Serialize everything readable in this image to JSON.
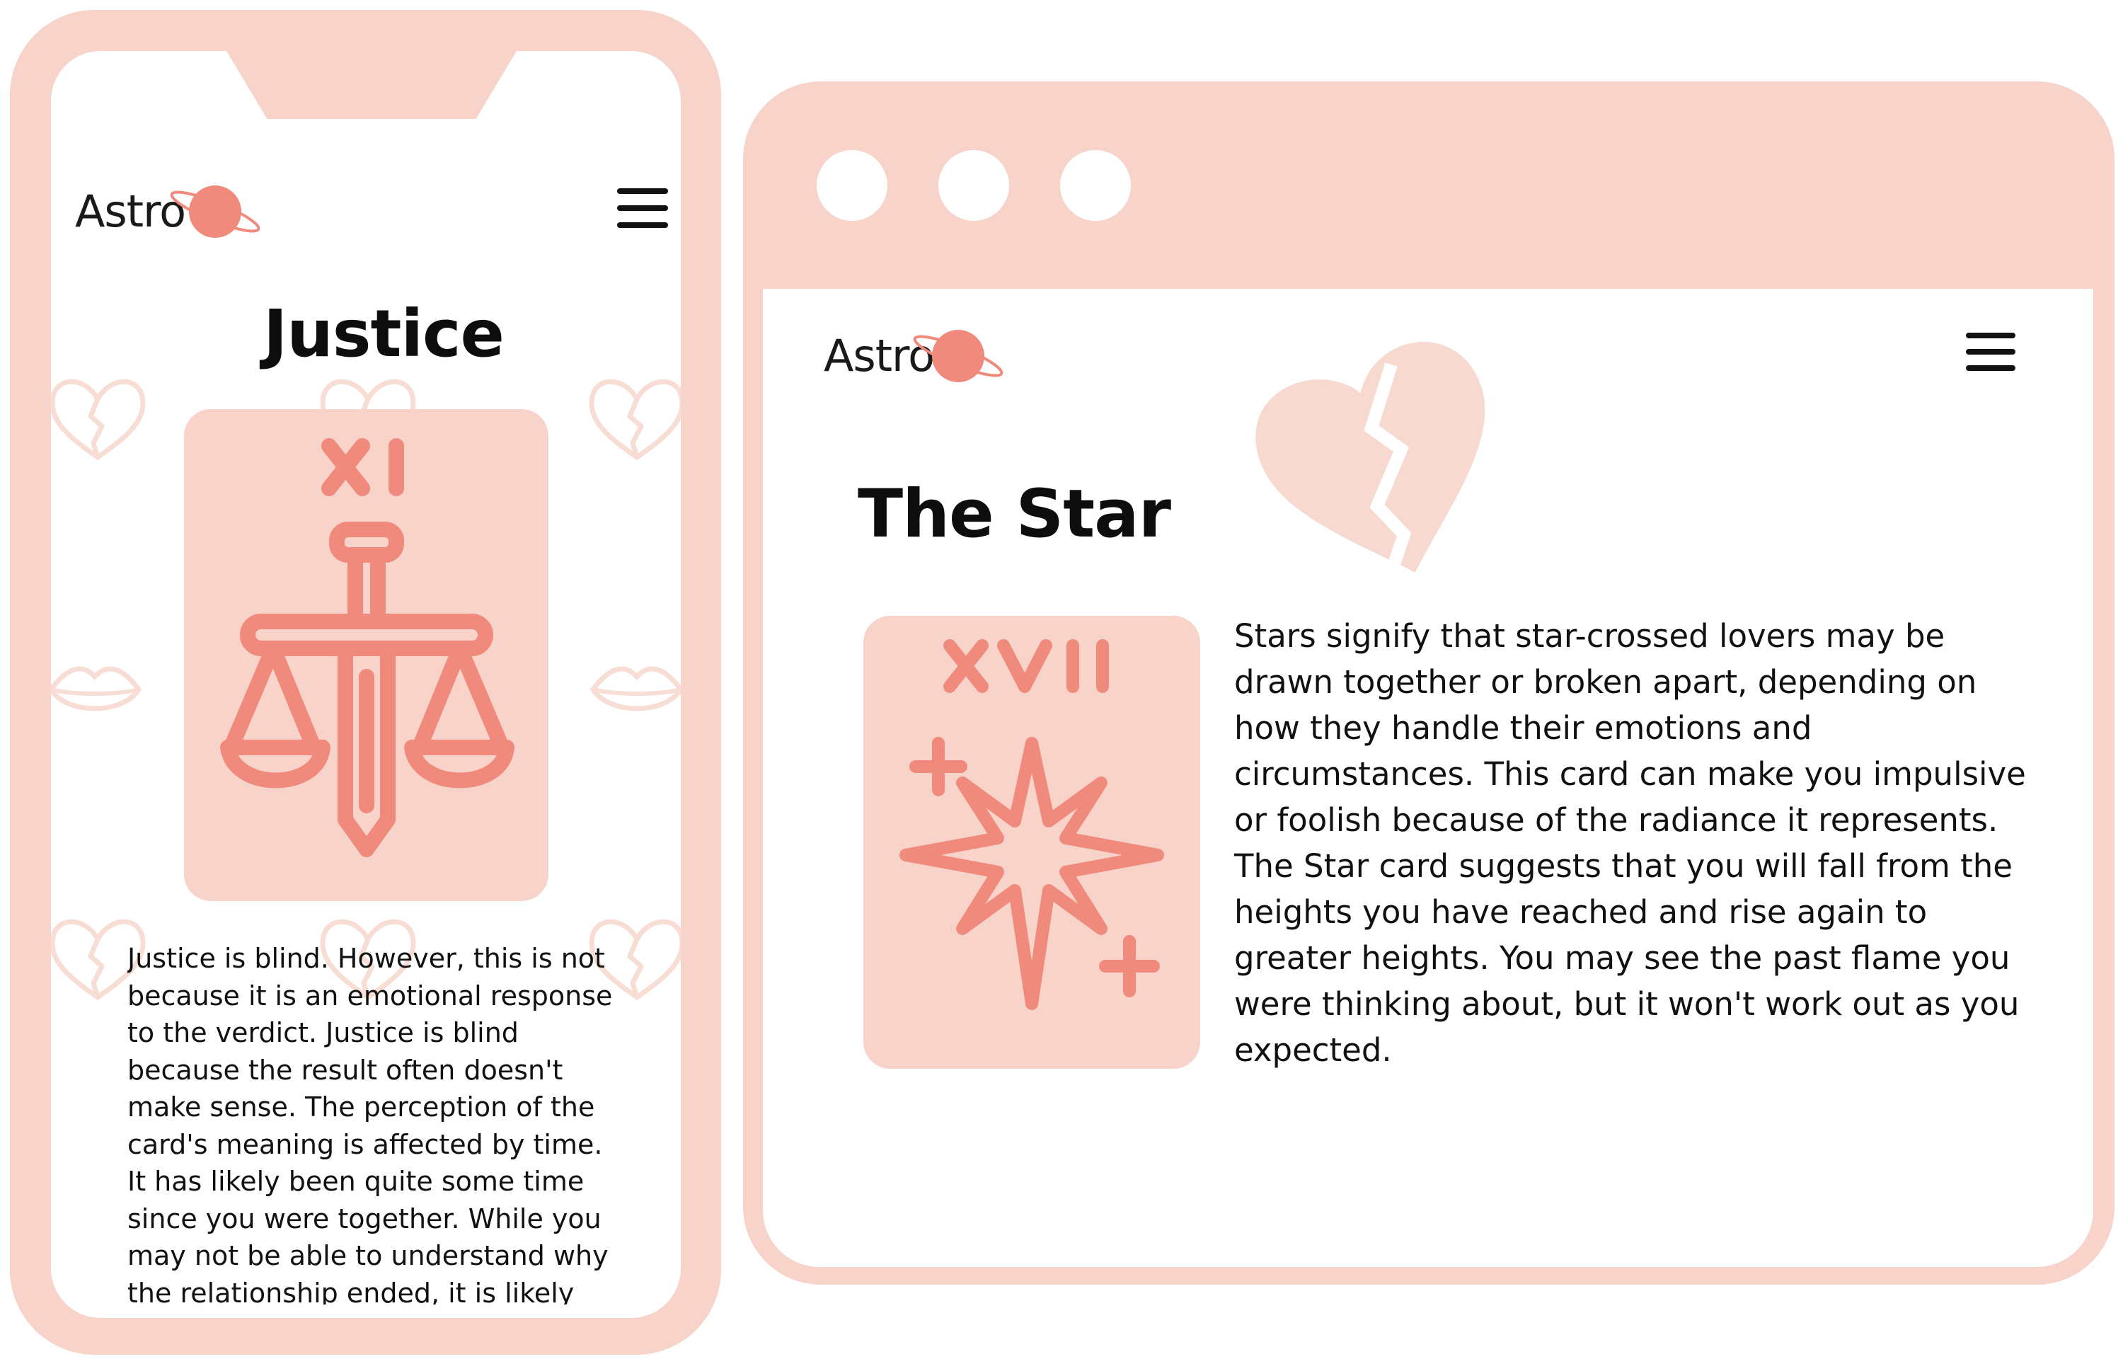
{
  "colors": {
    "frame": "#f7d3c9",
    "accent": "#f08a7c",
    "heart_light": "#f7d9d0",
    "text": "#111111"
  },
  "mobile": {
    "logo": "Astro",
    "menu_icon": "hamburger-menu-icon",
    "title": "Justice",
    "card_numeral": "XI",
    "card_icon": "sword-scales-icon",
    "background_icons": [
      "broken-heart-icon",
      "lips-icon"
    ],
    "body": "Justice is blind. However, this is not because it is an emotional response to the verdict. Justice is blind because the result often doesn't make sense. The perception of the card's meaning is affected by time. It has likely been quite some time since you were together. While you may not be able to understand why the relationship ended, it is likely"
  },
  "desktop": {
    "window_controls": [
      "window-dot",
      "window-dot",
      "window-dot"
    ],
    "logo": "Astro",
    "menu_icon": "hamburger-menu-icon",
    "title": "The Star",
    "decor_icon": "broken-heart-icon",
    "card_numeral": "XVII",
    "card_icon": "star-sparkle-icon",
    "body": "Stars signify that star-crossed lovers may be drawn together or broken apart, depending on how they handle their emotions and circumstances. This card can make you impulsive or foolish because of the radiance it represents. The Star card suggests that you will fall from the heights you have reached and rise again to greater heights. You may see the past flame you were thinking about, but it won't work out as you expected."
  }
}
